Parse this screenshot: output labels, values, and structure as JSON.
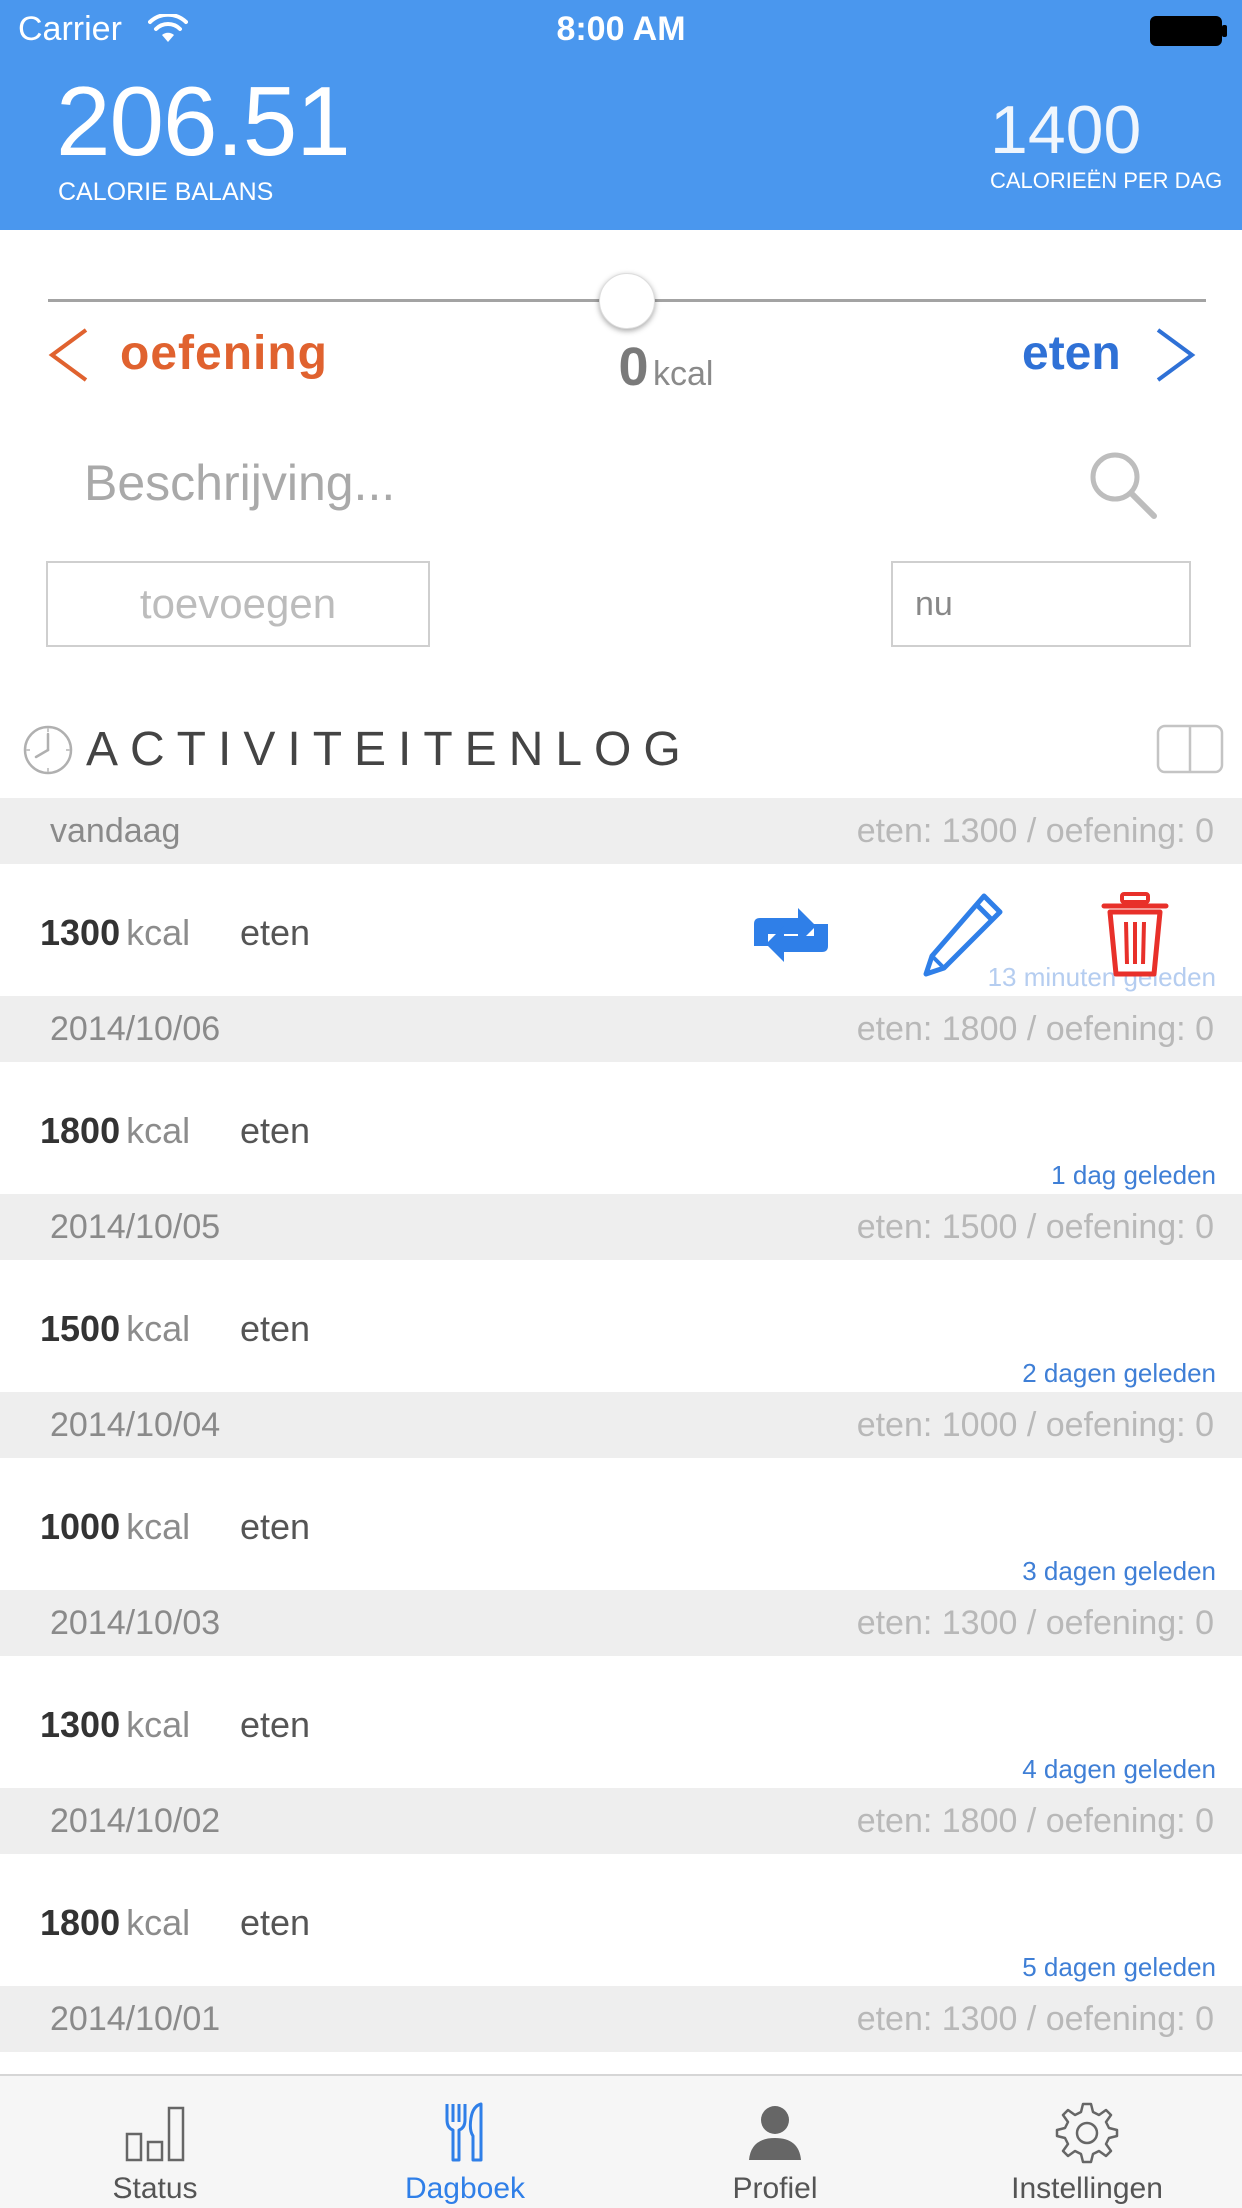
{
  "status_bar": {
    "carrier": "Carrier",
    "time": "8:00 AM"
  },
  "header": {
    "balance_value": "206.51",
    "balance_label": "CALORIE BALANS",
    "daily_value": "1400",
    "daily_label": "CALORIEËN PER DAG"
  },
  "input_panel": {
    "exercise_label": "oefening",
    "food_label": "eten",
    "kcal_value": "0",
    "kcal_unit": "kcal",
    "slider_value": 0.5,
    "description_placeholder": "Beschrijving...",
    "add_button_label": "toevoegen",
    "time_value": "nu"
  },
  "log": {
    "title": "ACTIVITEITENLOG",
    "days": [
      {
        "date": "vandaag",
        "summary": "eten: 1300 / oefening: 0",
        "entry": {
          "kcal": "1300",
          "unit": "kcal",
          "type": "eten",
          "ago": "13 minuten geleden"
        }
      },
      {
        "date": "2014/10/06",
        "summary": "eten: 1800 / oefening: 0",
        "entry": {
          "kcal": "1800",
          "unit": "kcal",
          "type": "eten",
          "ago": "1 dag geleden"
        }
      },
      {
        "date": "2014/10/05",
        "summary": "eten: 1500 / oefening: 0",
        "entry": {
          "kcal": "1500",
          "unit": "kcal",
          "type": "eten",
          "ago": "2 dagen geleden"
        }
      },
      {
        "date": "2014/10/04",
        "summary": "eten: 1000 / oefening: 0",
        "entry": {
          "kcal": "1000",
          "unit": "kcal",
          "type": "eten",
          "ago": "3 dagen geleden"
        }
      },
      {
        "date": "2014/10/03",
        "summary": "eten: 1300 / oefening: 0",
        "entry": {
          "kcal": "1300",
          "unit": "kcal",
          "type": "eten",
          "ago": "4 dagen geleden"
        }
      },
      {
        "date": "2014/10/02",
        "summary": "eten: 1800 / oefening: 0",
        "entry": {
          "kcal": "1800",
          "unit": "kcal",
          "type": "eten",
          "ago": "5 dagen geleden"
        }
      },
      {
        "date": "2014/10/01",
        "summary": "eten: 1300 / oefening: 0"
      }
    ]
  },
  "tabs": [
    {
      "label": "Status",
      "icon": "bar-chart-icon",
      "active": false
    },
    {
      "label": "Dagboek",
      "icon": "fork-knife-icon",
      "active": true
    },
    {
      "label": "Profiel",
      "icon": "person-icon",
      "active": false
    },
    {
      "label": "Instellingen",
      "icon": "gear-icon",
      "active": false
    }
  ],
  "colors": {
    "header_bg": "#4a97ee",
    "exercise": "#e0622f",
    "food": "#2f71d6",
    "delete": "#e8302a",
    "active_tab": "#2f7fe8"
  }
}
